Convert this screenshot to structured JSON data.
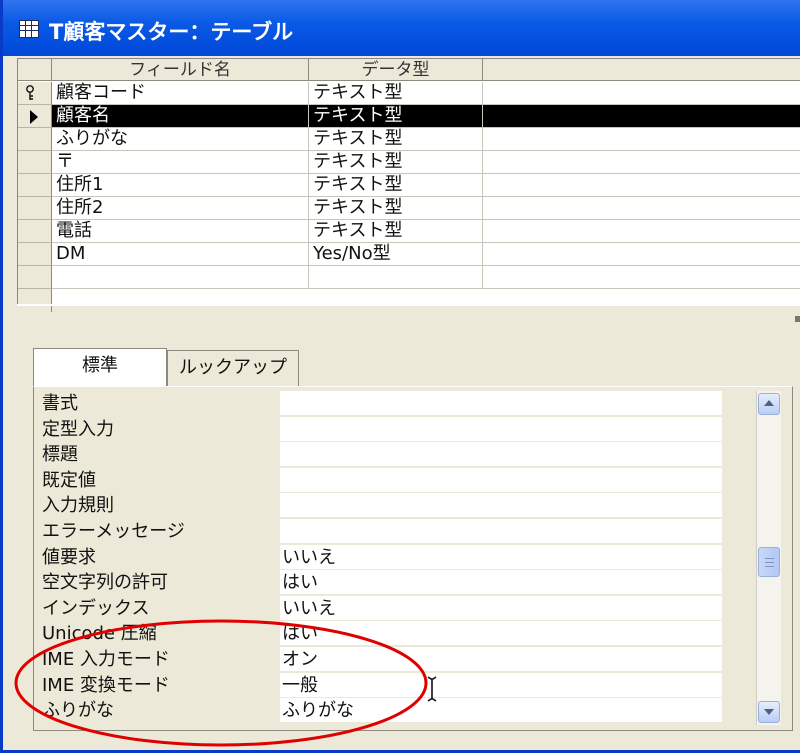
{
  "window": {
    "title": "T顧客マスター：テーブル"
  },
  "grid": {
    "headers": [
      "フィールド名",
      "データ型"
    ],
    "rows": [
      {
        "name": "顧客コード",
        "type": "テキスト型",
        "indicator": "key-icon"
      },
      {
        "name": "顧客名",
        "type": "テキスト型",
        "indicator": "current-row-arrow-icon"
      },
      {
        "name": "ふりがな",
        "type": "テキスト型"
      },
      {
        "name": "〒",
        "type": "テキスト型"
      },
      {
        "name": "住所1",
        "type": "テキスト型"
      },
      {
        "name": "住所2",
        "type": "テキスト型"
      },
      {
        "name": "電話",
        "type": "テキスト型"
      },
      {
        "name": "DM",
        "type": "Yes/No型"
      },
      {
        "name": "",
        "type": ""
      }
    ],
    "selected_index": 1
  },
  "tabs": [
    "標準",
    "ルックアップ"
  ],
  "properties": [
    {
      "label": "書式",
      "value": ""
    },
    {
      "label": "定型入力",
      "value": ""
    },
    {
      "label": "標題",
      "value": ""
    },
    {
      "label": "既定値",
      "value": ""
    },
    {
      "label": "入力規則",
      "value": ""
    },
    {
      "label": "エラーメッセージ",
      "value": ""
    },
    {
      "label": "値要求",
      "value": "いいえ"
    },
    {
      "label": "空文字列の許可",
      "value": "はい"
    },
    {
      "label": "インデックス",
      "value": "いいえ"
    },
    {
      "label": "Unicode 圧縮",
      "value": "はい"
    },
    {
      "label": "IME 入力モード",
      "value": "オン"
    },
    {
      "label": "IME 変換モード",
      "value": "一般"
    },
    {
      "label": "ふりがな",
      "value": "ふりがな"
    }
  ],
  "colors": {
    "titlebar": "#0a5ae6",
    "selection": "#000000",
    "annotation": "#e00000",
    "face": "#ece9d8"
  }
}
